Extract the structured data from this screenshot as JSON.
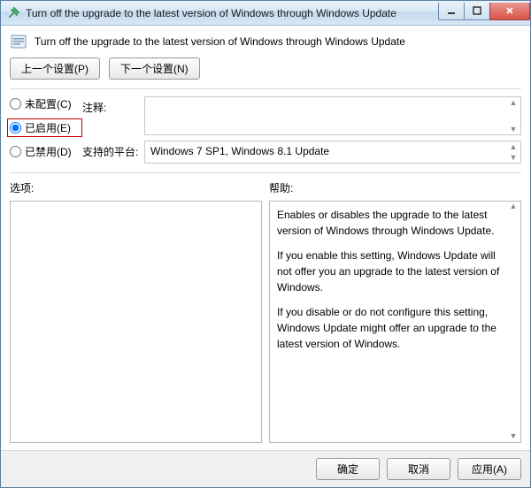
{
  "window": {
    "title": "Turn off the upgrade to the latest version of Windows through Windows Update"
  },
  "header": {
    "text": "Turn off the upgrade to the latest version of Windows through Windows Update"
  },
  "nav": {
    "prev": "上一个设置(P)",
    "next": "下一个设置(N)"
  },
  "radios": {
    "not_configured": "未配置(C)",
    "enabled": "已启用(E)",
    "disabled": "已禁用(D)",
    "selected": "enabled"
  },
  "fields": {
    "comment_label": "注释:",
    "comment_value": "",
    "platforms_label": "支持的平台:",
    "platforms_value": "Windows 7 SP1, Windows 8.1 Update"
  },
  "lower": {
    "options_label": "选项:",
    "help_label": "帮助:",
    "help_paragraphs": [
      "Enables or disables the upgrade to the latest version of Windows through Windows Update.",
      "If you enable this setting, Windows Update will not offer you an upgrade to the latest version of Windows.",
      "If you disable or do not configure this setting, Windows Update might offer an upgrade to the latest version of Windows."
    ]
  },
  "footer": {
    "ok": "确定",
    "cancel": "取消",
    "apply": "应用(A)"
  }
}
